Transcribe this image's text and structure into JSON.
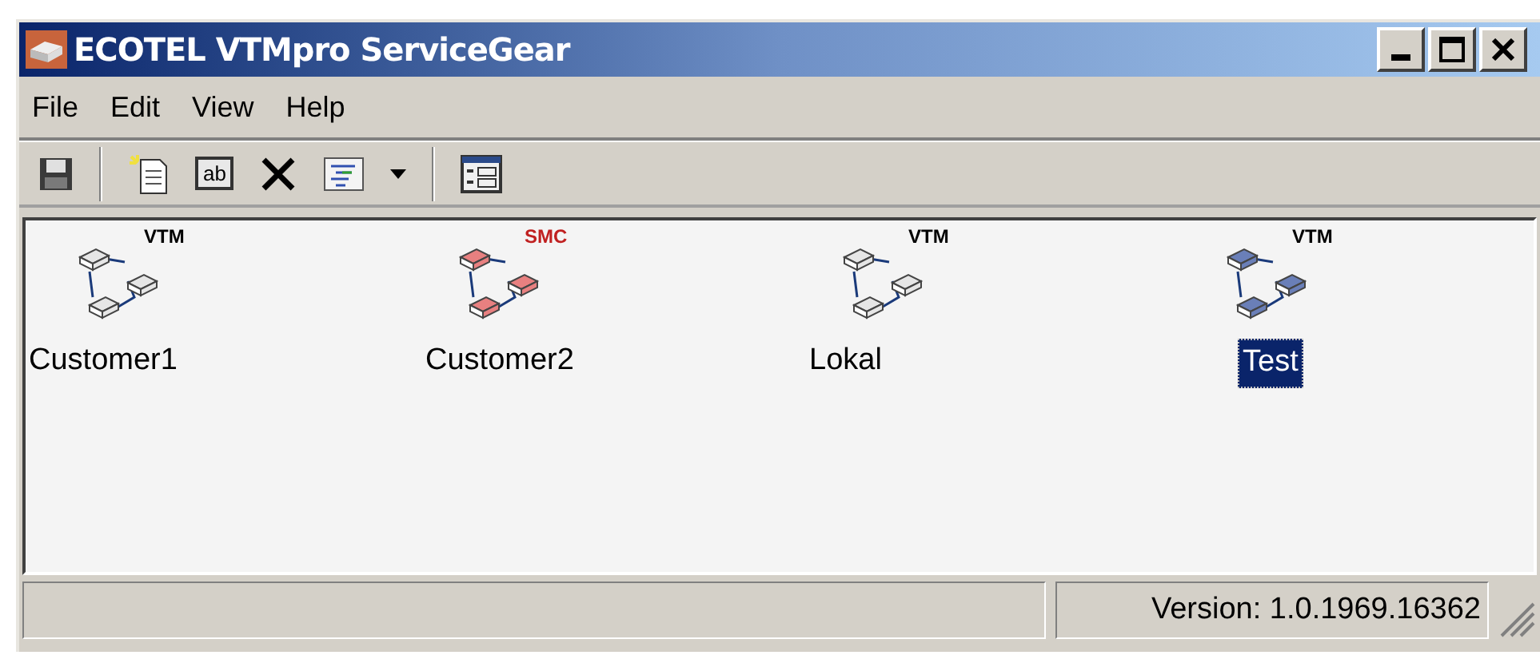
{
  "window": {
    "title": "ECOTEL VTMpro ServiceGear"
  },
  "menu": [
    "File",
    "Edit",
    "View",
    "Help"
  ],
  "toolbar": [
    {
      "kind": "save"
    },
    {
      "kind": "sep"
    },
    {
      "kind": "new"
    },
    {
      "kind": "rename",
      "text": "ab"
    },
    {
      "kind": "delete"
    },
    {
      "kind": "properties"
    },
    {
      "kind": "dropdown"
    },
    {
      "kind": "sep"
    },
    {
      "kind": "details"
    }
  ],
  "items": [
    {
      "label": "Customer1",
      "badge": "VTM",
      "kind": "vtm",
      "selected": false
    },
    {
      "label": "Customer2",
      "badge": "SMC",
      "kind": "smc",
      "selected": false
    },
    {
      "label": "Lokal",
      "badge": "VTM",
      "kind": "vtm",
      "selected": false
    },
    {
      "label": "Test",
      "badge": "VTM",
      "kind": "vtm",
      "selected": true
    }
  ],
  "status_bar": {
    "version": "Version: 1.0.1969.16362"
  }
}
